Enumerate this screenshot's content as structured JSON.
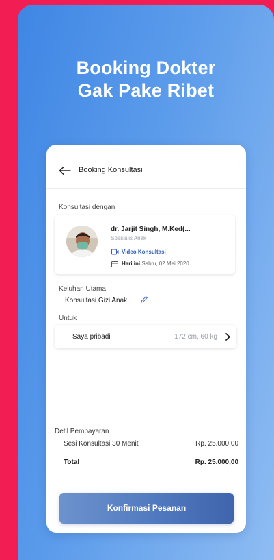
{
  "promo": {
    "headline_line1": "Booking Dokter",
    "headline_line2": "Gak Pake Ribet"
  },
  "header": {
    "back_icon": "arrow-left-icon",
    "title": "Booking Konsultasi"
  },
  "consult": {
    "label": "Konsultasi dengan",
    "doctor_name": "dr. Jarjit Singh, M.Ked(...",
    "specialty": "Spesialis Anak",
    "type_icon": "video-icon",
    "type_label": "Video Konsultasi",
    "date_icon": "calendar-icon",
    "date_prefix": "Hari ini",
    "date_value": "Sabtu, 02 Mei 2020"
  },
  "complaint": {
    "label": "Keluhan Utama",
    "value": "Konsultasi Gizi Anak",
    "edit_icon": "pencil-icon"
  },
  "patient": {
    "label": "Untuk",
    "name": "Saya pribadi",
    "meta": "172 cm, 60 kg",
    "chevron_icon": "chevron-right-icon"
  },
  "payment": {
    "label": "Detil Pembayaran",
    "items": [
      {
        "name": "Sesi Konsultasi 30 Menit",
        "amount": "Rp. 25.000,00"
      }
    ],
    "total_label": "Total",
    "total_amount": "Rp. 25.000,00"
  },
  "actions": {
    "confirm_label": "Konfirmasi Pesanan"
  },
  "colors": {
    "background": "#f21e53",
    "gradient_start": "#3f86e4",
    "gradient_end": "#8fbcf2",
    "accent": "#3460b8",
    "button": "#5179bf"
  }
}
